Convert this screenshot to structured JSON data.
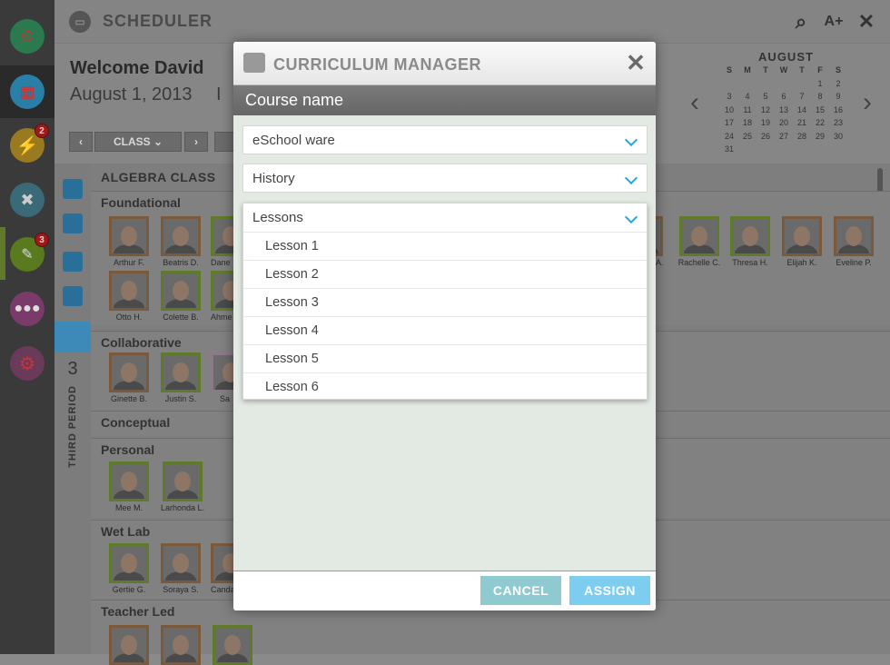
{
  "app": {
    "title": "SCHEDULER",
    "icons": [
      "scheduler-icon",
      "search-icon",
      "grade-icon",
      "close-icon"
    ]
  },
  "rail": {
    "badges": {
      "alerts": "2",
      "assignments": "3"
    }
  },
  "header": {
    "welcome": "Welcome David",
    "date": "August 1, 2013",
    "date_sep": "I"
  },
  "classnav": {
    "class_label": "CLASS"
  },
  "calendar": {
    "month": "AUGUST",
    "weekdays": [
      "S",
      "M",
      "T",
      "W",
      "T",
      "F",
      "S"
    ],
    "days": [
      "",
      "",
      "",
      "",
      "",
      "1",
      "2",
      "3",
      "4",
      "5",
      "6",
      "7",
      "8",
      "9",
      "10",
      "11",
      "12",
      "13",
      "14",
      "15",
      "16",
      "17",
      "18",
      "19",
      "20",
      "21",
      "22",
      "23",
      "24",
      "25",
      "26",
      "27",
      "28",
      "29",
      "30",
      "31"
    ]
  },
  "period": {
    "number": "3",
    "label": "THIRD PERIOD"
  },
  "board": {
    "class_title": "ALGEBRA CLASS",
    "groups": [
      {
        "title": "Foundational",
        "students": [
          "Arthur F.",
          "Beatris D.",
          "Dane",
          "Otto H.",
          "Colette B.",
          "Ahme"
        ],
        "right_students": [
          "A.",
          "Rachelle C.",
          "Thresa H.",
          "Elijah K.",
          "Eveline P."
        ]
      },
      {
        "title": "Collaborative",
        "students": [
          "Ginette B.",
          "Justin S.",
          "Sa"
        ]
      },
      {
        "title": "Conceptual",
        "students": []
      },
      {
        "title": "Personal",
        "students": [
          "Mee M.",
          "Larhonda L."
        ]
      },
      {
        "title": "Wet Lab",
        "students": [
          "Gertie G.",
          "Soraya S.",
          "Canda"
        ]
      },
      {
        "title": "Teacher Led",
        "students": []
      }
    ]
  },
  "modal": {
    "title": "CURRICULUM MANAGER",
    "subtitle": "Course name",
    "selects": [
      "eSchool ware",
      "History",
      "Lessons"
    ],
    "lessons": [
      "Lesson 1",
      "Lesson 2",
      "Lesson 3",
      "Lesson 4",
      "Lesson 5",
      "Lesson 6"
    ],
    "cancel_label": "CANCEL",
    "assign_label": "ASSIGN",
    "colors": {
      "accent": "#2aa8e0",
      "cancel": "#8fcad0",
      "assign": "#7ccdf0"
    }
  }
}
